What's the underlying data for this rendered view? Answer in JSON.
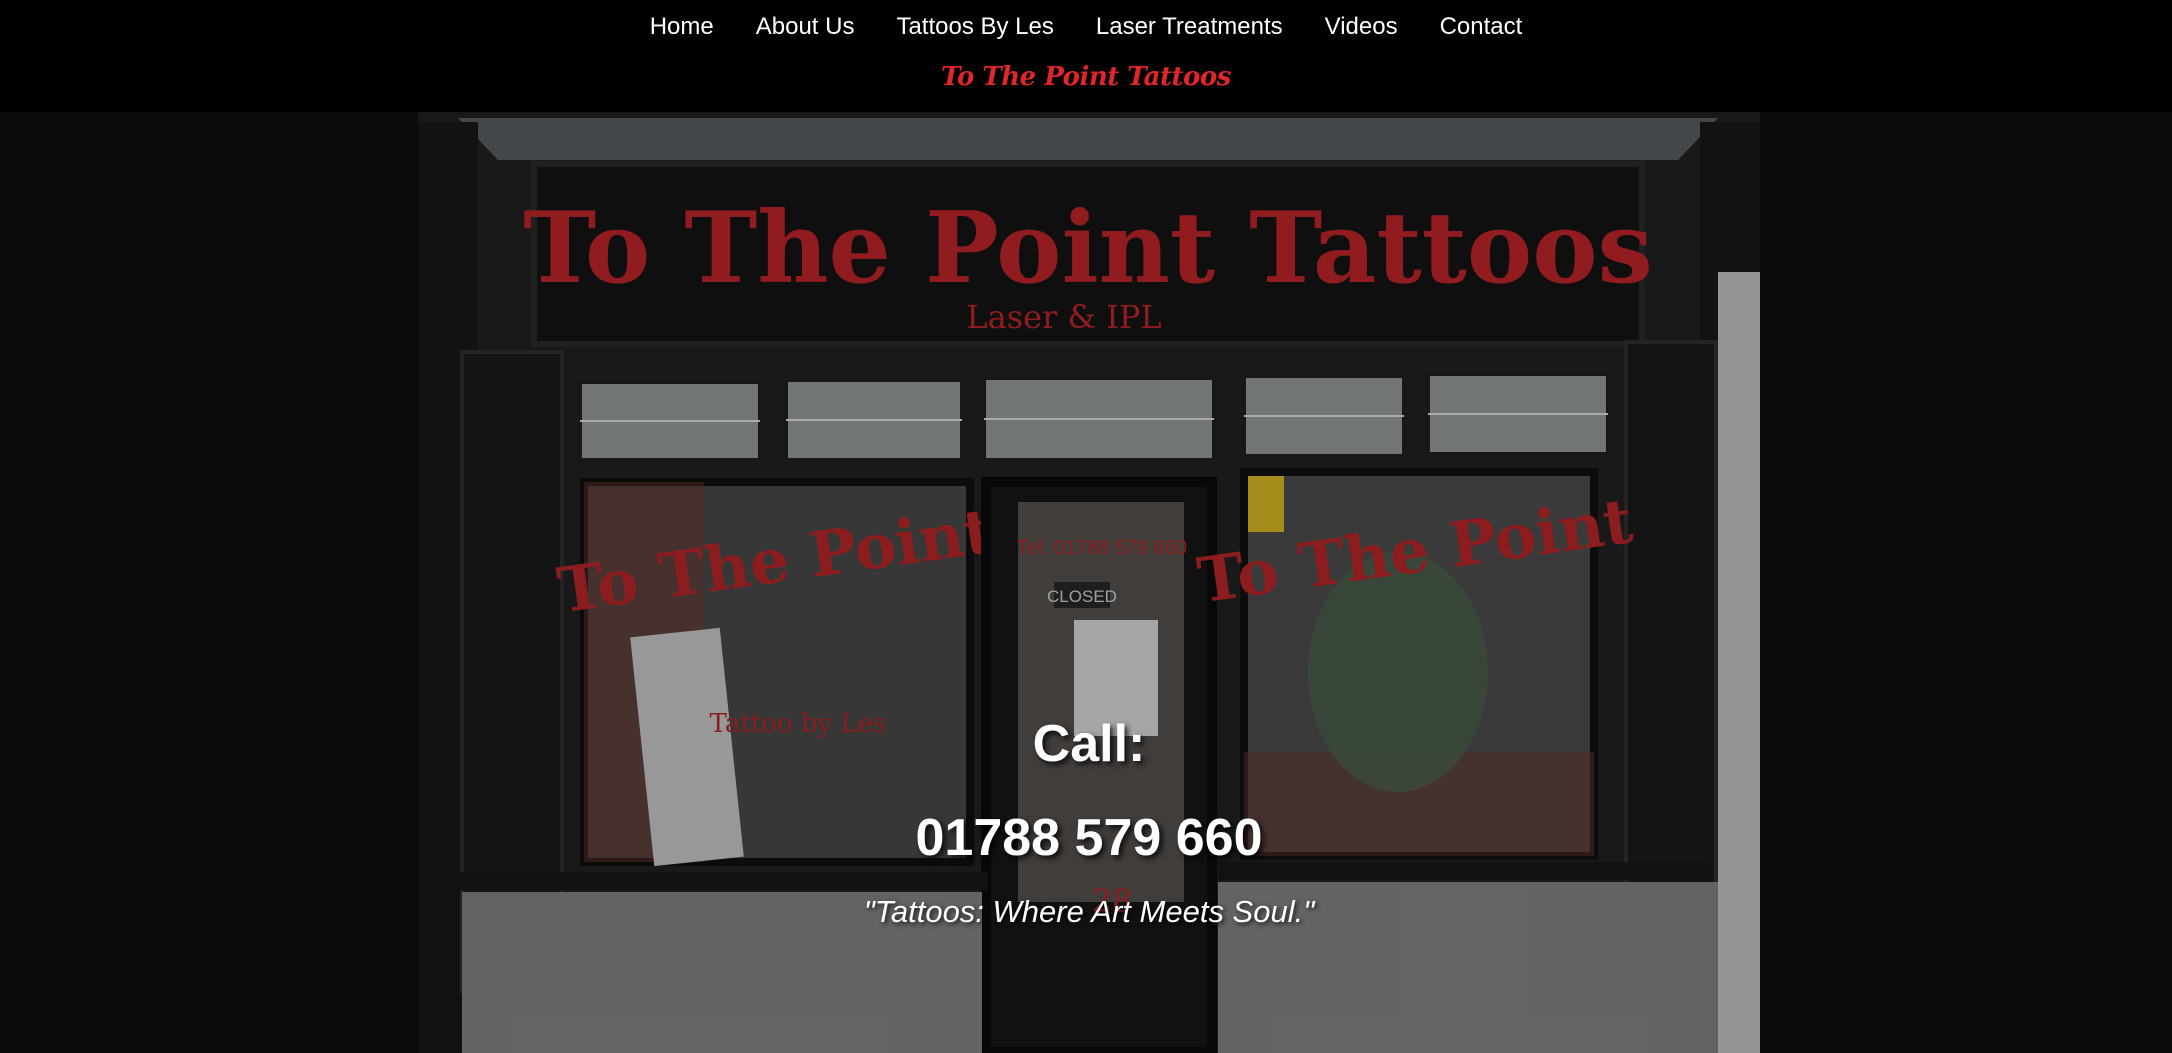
{
  "nav": {
    "items": [
      {
        "label": "Home"
      },
      {
        "label": "About Us"
      },
      {
        "label": "Tattoos By Les"
      },
      {
        "label": "Laser Treatments"
      },
      {
        "label": "Videos"
      },
      {
        "label": "Contact"
      }
    ]
  },
  "brand": {
    "name": "To The Point Tattoos"
  },
  "hero": {
    "shop_sign_title": "To The Point Tattoos",
    "shop_sign_subtitle": "Laser & IPL",
    "window_left_text": "To The Point",
    "window_left_caption": "Tattoo by Les",
    "window_right_text": "To The Point",
    "door_phone": "Tel: 01788 579 660",
    "door_sign": "CLOSED",
    "door_number": "28",
    "call_label": "Call:",
    "call_number": "01788 579 660",
    "tagline": "\"Tattoos: Where Art Meets Soul.\""
  },
  "colors": {
    "header_bg": "#000000",
    "page_bg": "#0b0b0b",
    "brand_red": "#e0262b",
    "nav_text": "#ffffff"
  }
}
